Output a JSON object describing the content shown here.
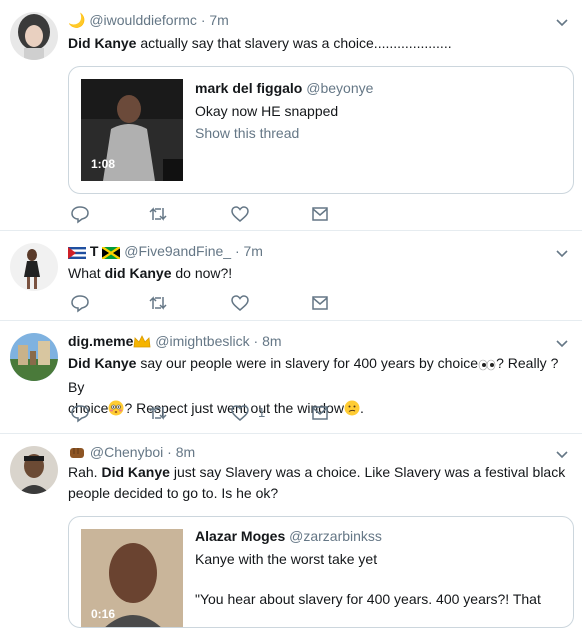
{
  "tweets": [
    {
      "flag": "🌙",
      "display_name": "",
      "handle": "@iwoulddieformc",
      "time": "7m",
      "text_bold": "Did Kanye",
      "text_rest": " actually say that slavery was a choice....................",
      "quote": {
        "name": "mark del figgalo",
        "handle": "@beyonye",
        "line1": "Okay now HE snapped",
        "link": "Show this thread",
        "duration": "1:08"
      }
    },
    {
      "display_name": "T",
      "handle": "@Five9andFine_",
      "time": "7m",
      "text_pre": "What ",
      "text_bold": "did Kanye",
      "text_rest": " do now?!"
    },
    {
      "display_name": "dig.meme",
      "handle": "@imightbeslick",
      "time": "8m",
      "text_bold": "Did Kanye",
      "text_rest": " say our people were in slavery for 400 years by choice",
      "text_rest2": "? Really ? By",
      "line2a": "choice",
      "line2b": "? Respect just went out the window",
      "line2c": ".",
      "likes": "1"
    },
    {
      "display_name": "",
      "handle": "@Chenyboi",
      "time": "8m",
      "text_pre": "Rah. ",
      "text_bold": "Did Kanye",
      "text_rest": " just say Slavery was a choice. Like Slavery was a festival black",
      "line2": "people decided to go to. Is he ok?",
      "quote": {
        "name": "Alazar Moges",
        "handle": "@zarzarbinkss",
        "line1": "Kanye with the worst take yet",
        "line2": "\"You hear about slavery for 400 years. 400 years?! That",
        "duration": "0:16"
      }
    }
  ],
  "separator": "·",
  "colors": {
    "text": "#14171a",
    "muted": "#657786",
    "border": "#e6ecf0",
    "icon": "#657786"
  },
  "icons": [
    "reply-icon",
    "retweet-icon",
    "like-icon",
    "message-icon",
    "chevron-down-icon"
  ]
}
